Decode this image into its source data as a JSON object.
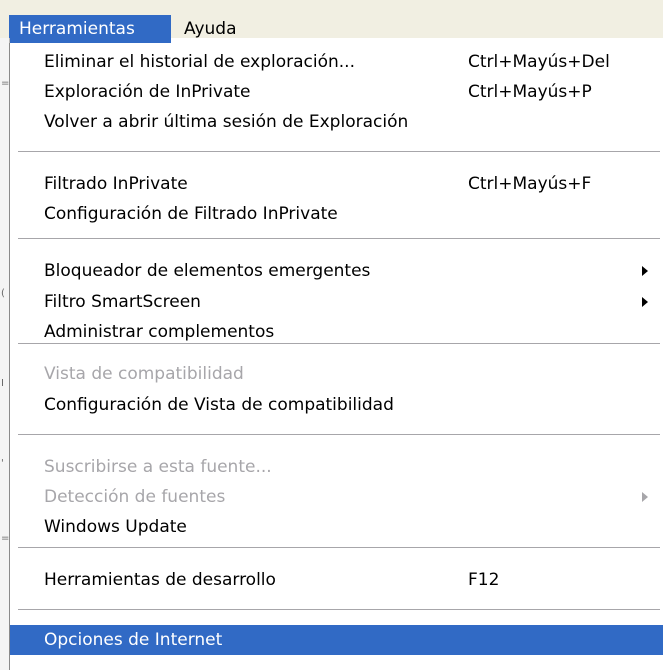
{
  "menubar": {
    "items": [
      {
        "label": "Herramientas",
        "active": true
      },
      {
        "label": "Ayuda",
        "active": false
      }
    ]
  },
  "menu": {
    "groups": [
      [
        {
          "label": "Eliminar el historial de exploración...",
          "shortcut": "Ctrl+Mayús+Del",
          "enabled": true
        },
        {
          "label": "Exploración de InPrivate",
          "shortcut": "Ctrl+Mayús+P",
          "enabled": true
        },
        {
          "label": "Volver a abrir última sesión de Exploración",
          "shortcut": "",
          "enabled": true
        }
      ],
      [
        {
          "label": "Filtrado InPrivate",
          "shortcut": "Ctrl+Mayús+F",
          "enabled": true
        },
        {
          "label": "Configuración de Filtrado InPrivate",
          "shortcut": "",
          "enabled": true
        }
      ],
      [
        {
          "label": "Bloqueador de elementos emergentes",
          "shortcut": "",
          "enabled": true,
          "submenu": true
        },
        {
          "label": "Filtro SmartScreen",
          "shortcut": "",
          "enabled": true,
          "submenu": true
        },
        {
          "label": "Administrar complementos",
          "shortcut": "",
          "enabled": true
        }
      ],
      [
        {
          "label": "Vista de compatibilidad",
          "shortcut": "",
          "enabled": false
        },
        {
          "label": "Configuración de Vista de compatibilidad",
          "shortcut": "",
          "enabled": true
        }
      ],
      [
        {
          "label": "Suscribirse a esta fuente...",
          "shortcut": "",
          "enabled": false
        },
        {
          "label": "Detección de fuentes",
          "shortcut": "",
          "enabled": false,
          "submenu": true
        },
        {
          "label": "Windows Update",
          "shortcut": "",
          "enabled": true
        }
      ],
      [
        {
          "label": "Herramientas de desarrollo",
          "shortcut": "F12",
          "enabled": true
        }
      ],
      [
        {
          "label": "Opciones de Internet",
          "shortcut": "",
          "enabled": true,
          "selected": true
        }
      ]
    ]
  },
  "colors": {
    "highlight": "#316ac5",
    "disabled_text": "#a7a6aa",
    "menubar_bg": "#f1efe2"
  },
  "icons": {
    "submenu": "submenu-arrow-icon"
  }
}
